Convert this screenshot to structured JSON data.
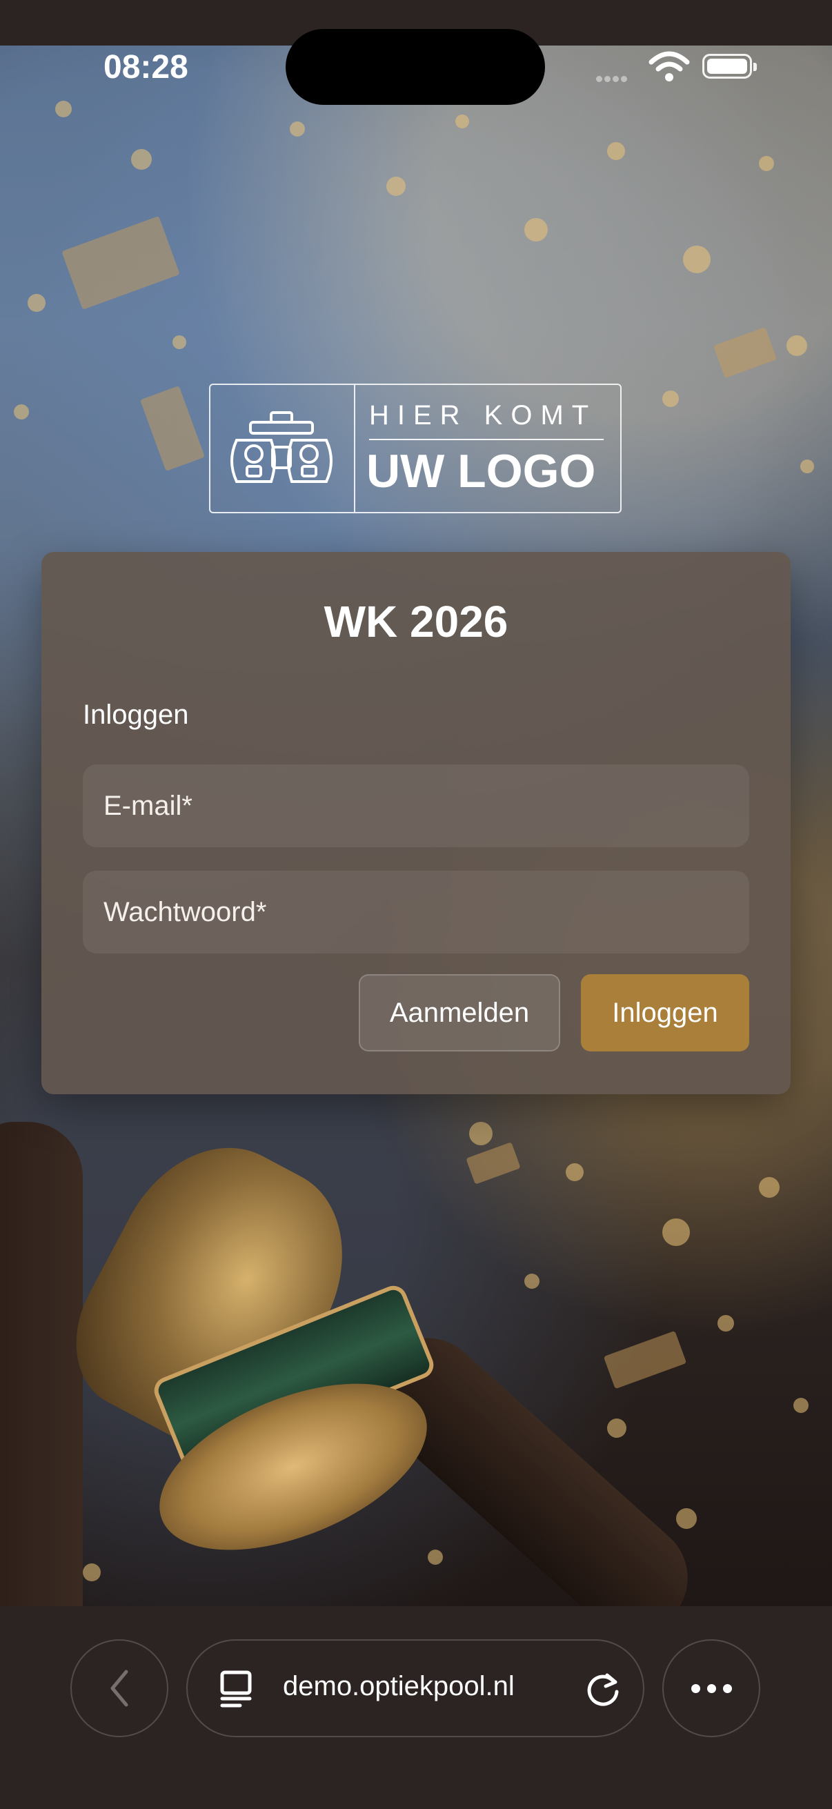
{
  "status_bar": {
    "time": "08:28"
  },
  "logo": {
    "line1": "HIER KOMT",
    "line2": "UW LOGO"
  },
  "login": {
    "title": "WK 2026",
    "subtitle": "Inloggen",
    "email_placeholder": "E-mail*",
    "password_placeholder": "Wachtwoord*",
    "register_label": "Aanmelden",
    "login_label": "Inloggen"
  },
  "browser": {
    "url": "demo.optiekpool.nl"
  },
  "colors": {
    "accent": "#a97f3a",
    "chrome": "#2b2423"
  },
  "icons": [
    "wifi-icon",
    "battery-icon",
    "back-chevron-icon",
    "tabs-icon",
    "reload-icon",
    "more-dots-icon"
  ]
}
